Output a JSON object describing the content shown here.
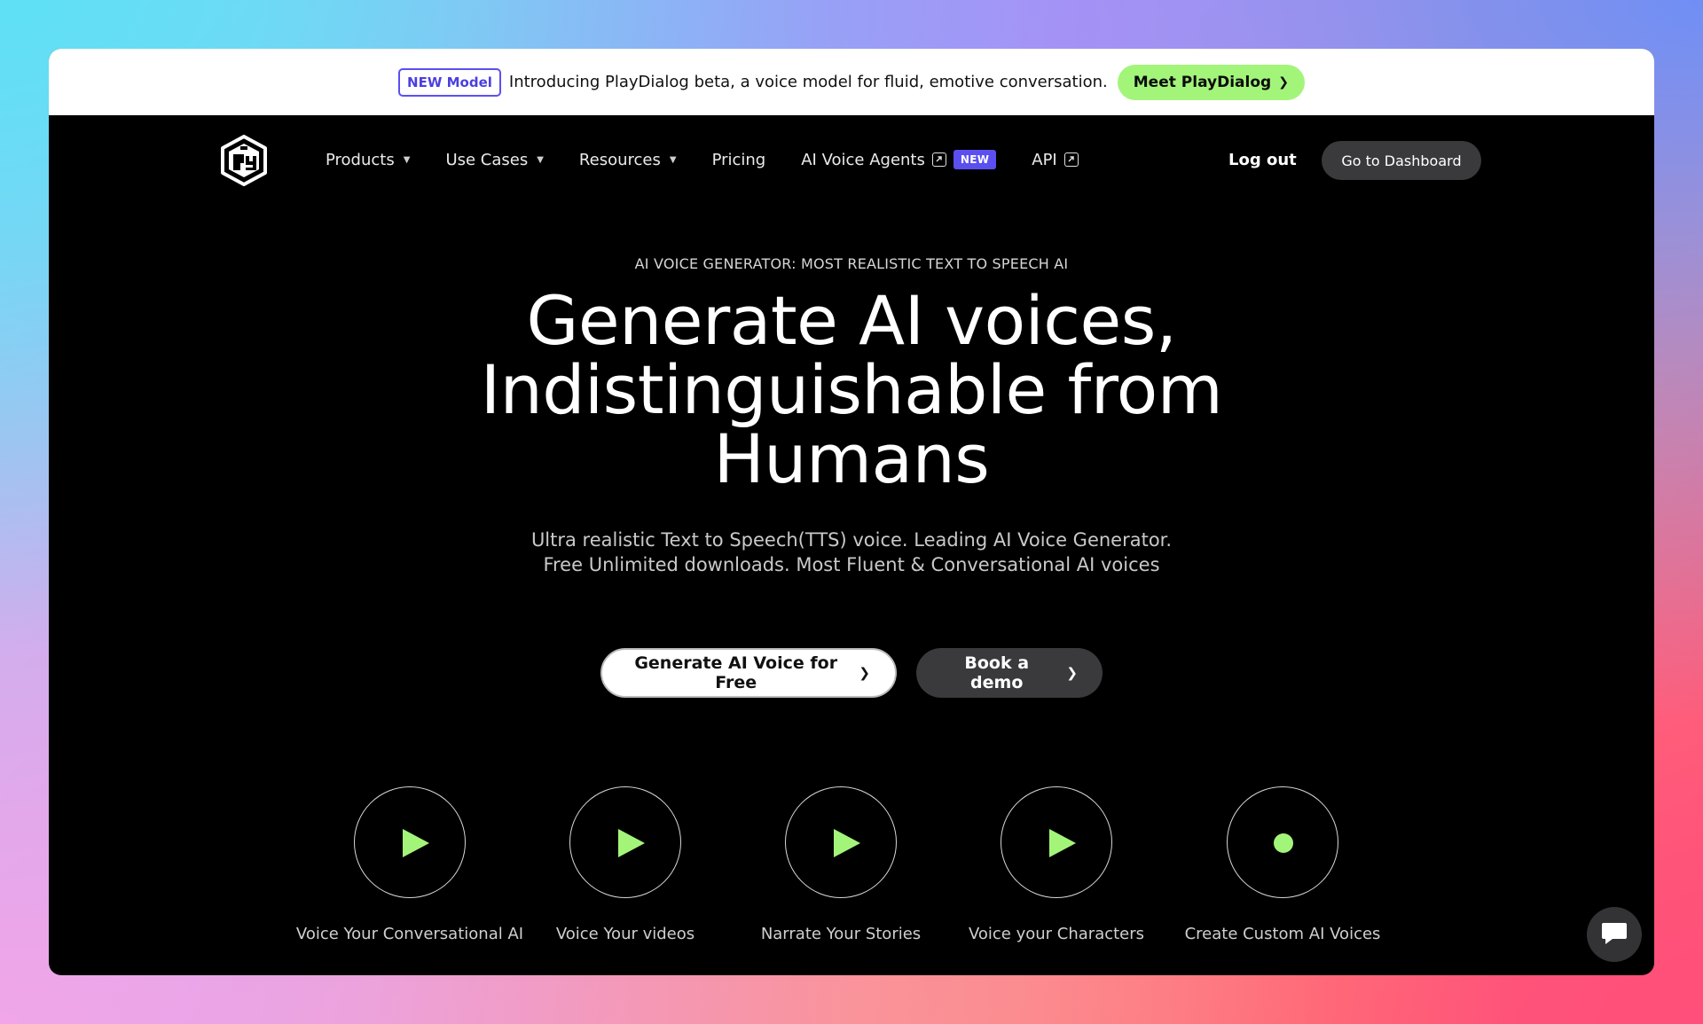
{
  "announcement": {
    "badge": "NEW Model",
    "text": "Introducing PlayDialog beta, a voice model for fluid, emotive conversation.",
    "cta_label": "Meet PlayDialog",
    "cta_icon": "chevron-right-icon"
  },
  "nav": {
    "logo_name": "playht-logo",
    "items": [
      {
        "label": "Products",
        "icon": "caret-down-icon"
      },
      {
        "label": "Use Cases",
        "icon": "caret-down-icon"
      },
      {
        "label": "Resources",
        "icon": "caret-down-icon"
      },
      {
        "label": "Pricing"
      },
      {
        "label": "AI Voice Agents",
        "icon": "external-link-icon",
        "tag": "NEW"
      },
      {
        "label": "API",
        "icon": "external-link-icon"
      }
    ],
    "logout_label": "Log out",
    "dashboard_label": "Go to Dashboard"
  },
  "hero": {
    "eyebrow": "AI VOICE GENERATOR: MOST REALISTIC TEXT TO SPEECH AI",
    "headline_line1": "Generate AI voices,",
    "headline_line2": "Indistinguishable from",
    "headline_line3": "Humans",
    "subtitle_line1": "Ultra realistic Text to Speech(TTS) voice. Leading AI Voice Generator.",
    "subtitle_line2": "Free Unlimited downloads. Most Fluent & Conversational AI voices",
    "primary_cta": "Generate AI Voice for Free",
    "secondary_cta": "Book a demo"
  },
  "features": [
    {
      "label": "Voice Your Conversational AI",
      "icon": "play-icon"
    },
    {
      "label": "Voice Your videos",
      "icon": "play-icon"
    },
    {
      "label": "Narrate Your Stories",
      "icon": "play-icon"
    },
    {
      "label": "Voice your Characters",
      "icon": "play-icon"
    },
    {
      "label": "Create Custom AI Voices",
      "icon": "record-dot-icon"
    }
  ],
  "chat": {
    "icon": "chat-bubble-icon"
  },
  "colors": {
    "accent_green": "#a3f57a",
    "accent_purple": "#5b4ff0",
    "background": "#000000"
  }
}
